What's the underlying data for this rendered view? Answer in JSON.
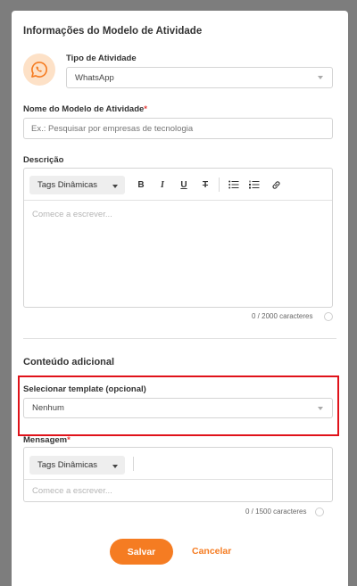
{
  "modal": {
    "title": "Informações do Modelo de Atividade"
  },
  "activity_type": {
    "label": "Tipo de Atividade",
    "value": "WhatsApp",
    "icon": "whatsapp-icon",
    "icon_color": "#f57c22"
  },
  "model_name": {
    "label": "Nome do Modelo de Atividade",
    "required_mark": "*",
    "placeholder": "Ex.: Pesquisar por empresas de tecnologia"
  },
  "description": {
    "label": "Descrição",
    "tags_label": "Tags Dinâmicas",
    "toolbar": {
      "bold": "B",
      "italic": "I",
      "underline": "U",
      "strike": "T"
    },
    "placeholder": "Comece a escrever...",
    "counter": "0 / 2000 caracteres"
  },
  "additional": {
    "title": "Conteúdo adicional",
    "template_label": "Selecionar template (opcional)",
    "template_value": "Nenhum",
    "message_label": "Mensagem",
    "required_mark": "*",
    "tags_label": "Tags Dinâmicas",
    "placeholder": "Comece a escrever...",
    "counter": "0 / 1500 caracteres"
  },
  "actions": {
    "save": "Salvar",
    "cancel": "Cancelar"
  },
  "colors": {
    "accent": "#f57c22",
    "highlight": "#e0121a",
    "required": "#e53935"
  }
}
